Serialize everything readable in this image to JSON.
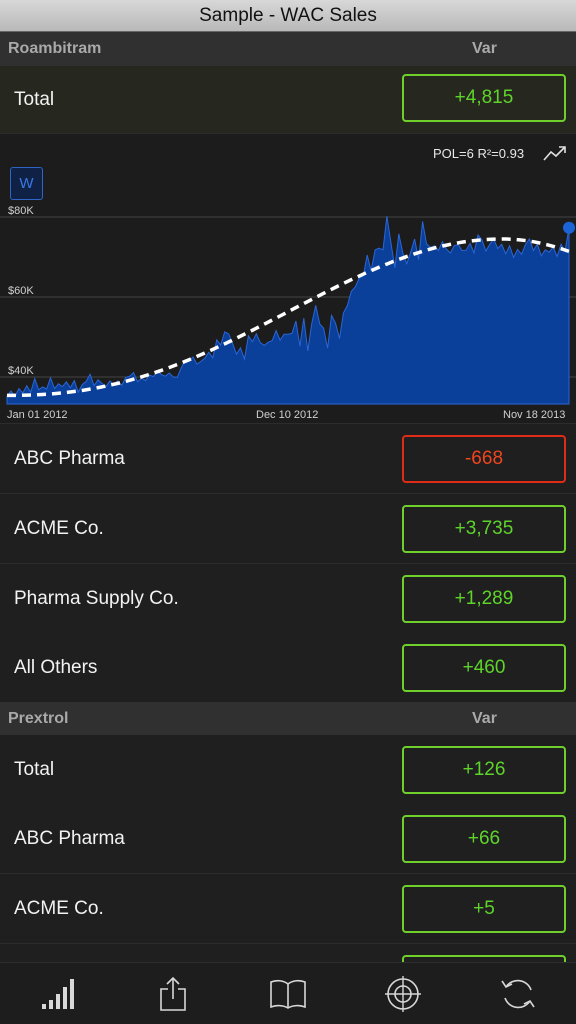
{
  "title": "Sample - WAC Sales",
  "sections": [
    {
      "name": "Roambitram",
      "var_label": "Var",
      "total": {
        "label": "Total",
        "value": "+4,815"
      },
      "rows": [
        {
          "label": "ABC Pharma",
          "value": "-668",
          "negative": true
        },
        {
          "label": "ACME Co.",
          "value": "+3,735"
        },
        {
          "label": "Pharma Supply Co.",
          "value": "+1,289"
        },
        {
          "label": "All Others",
          "value": "+460"
        }
      ]
    },
    {
      "name": "Prextrol",
      "var_label": "Var",
      "total": {
        "label": "Total",
        "value": "+126"
      },
      "rows": [
        {
          "label": "ABC Pharma",
          "value": "+66"
        },
        {
          "label": "ACME Co.",
          "value": "+5"
        }
      ]
    }
  ],
  "chart_data": {
    "type": "area",
    "period_button": "W",
    "fit_stat": "POL=6 R²=0.93",
    "x_tick_labels": [
      "Jan 01 2012",
      "Dec 10 2012",
      "Nov 18 2013"
    ],
    "y_tick_labels": [
      "$80K",
      "$60K",
      "$40K"
    ],
    "ylim": [
      33000,
      82000
    ],
    "colors": {
      "area": "#0a3f9a",
      "line": "#2a66d8",
      "trend": "#ffffff"
    },
    "values": [
      35200,
      36500,
      35100,
      37100,
      36000,
      37800,
      36200,
      39600,
      36800,
      37500,
      37000,
      39800,
      37100,
      38300,
      37600,
      38800,
      37300,
      39100,
      36200,
      38100,
      38900,
      40700,
      37800,
      39300,
      38400,
      37600,
      39000,
      38100,
      39000,
      37900,
      39900,
      40200,
      41100,
      38800,
      39700,
      39100,
      40500,
      40100,
      41500,
      40600,
      40200,
      41000,
      40000,
      39900,
      42200,
      44300,
      44100,
      45000,
      43200,
      43900,
      44700,
      46200,
      44800,
      49300,
      48000,
      51300,
      50800,
      48400,
      45700,
      47300,
      44500,
      50300,
      48800,
      50800,
      48600,
      47900,
      48700,
      49100,
      51600,
      49200,
      50700,
      50700,
      50900,
      54000,
      47700,
      54700,
      46500,
      53300,
      57900,
      53300,
      52200,
      47200,
      55400,
      53500,
      49600,
      56000,
      57900,
      61400,
      62500,
      64700,
      65200,
      70500,
      66500,
      71800,
      72200,
      71800,
      80200,
      73600,
      67300,
      75800,
      71000,
      68300,
      71200,
      74500,
      69300,
      78900,
      73300,
      72400,
      72800,
      71600,
      73800,
      72000,
      71000,
      72800,
      73100,
      71600,
      71700,
      73400,
      71000,
      75500,
      74300,
      71500,
      73200,
      74400,
      72100,
      73200,
      70800,
      72800,
      69900,
      71900,
      70700,
      73100,
      74500,
      71600,
      73200,
      70300,
      71800,
      71200,
      72500,
      70100,
      73200,
      71400,
      77300
    ],
    "trend": {
      "start": 35400,
      "end": 71400,
      "peak": 74500
    }
  },
  "tabbar": {
    "icons": [
      "chart-bars-icon",
      "share-icon",
      "book-icon",
      "target-icon",
      "refresh-icon"
    ]
  }
}
